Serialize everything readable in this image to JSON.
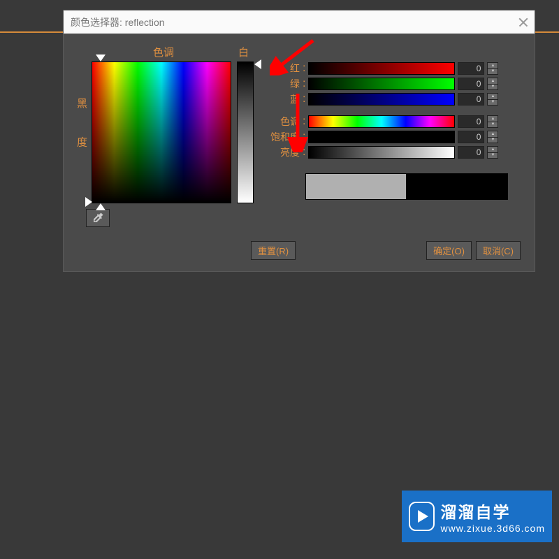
{
  "dialog": {
    "title": "颜色选择器: reflection"
  },
  "labels": {
    "hue": "色调",
    "whiteness": "白度",
    "blackness": "黑 度"
  },
  "channels": {
    "red": {
      "label": "红",
      "value": "0"
    },
    "green": {
      "label": "绿",
      "value": "0"
    },
    "blue": {
      "label": "蓝",
      "value": "0"
    },
    "hue": {
      "label": "色调",
      "value": "0"
    },
    "sat": {
      "label": "饱和度",
      "value": "0"
    },
    "val": {
      "label": "亮度",
      "value": "0"
    }
  },
  "buttons": {
    "reset": "重置(R)",
    "ok": "确定(O)",
    "cancel": "取消(C)"
  },
  "swatch": {
    "new": "#b0b0b0",
    "old": "#000000"
  },
  "watermark": {
    "main": "溜溜自学",
    "sub": "www.zixue.3d66.com"
  }
}
